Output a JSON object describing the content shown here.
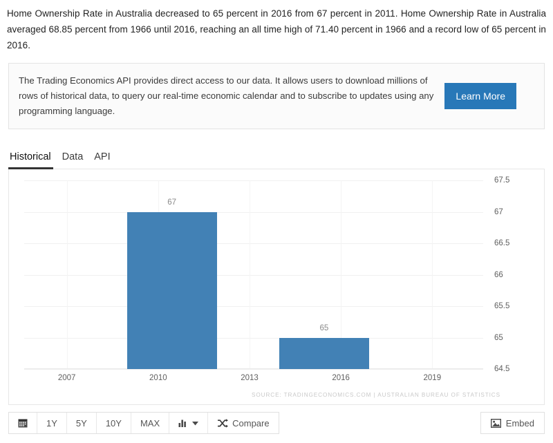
{
  "intro": {
    "paragraph": "Home Ownership Rate in Australia decreased to 65 percent in 2016 from 67 percent in 2011. Home Ownership Rate in Australia averaged 68.85 percent from 1966 until 2016, reaching an all time high of 71.40 percent in 1966 and a record low of 65 percent in 2016."
  },
  "api_promo": {
    "text": "The Trading Economics API provides direct access to our data. It allows users to download millions of rows of historical data, to query our real-time economic calendar and to subscribe to updates using any programming language.",
    "button_label": "Learn More",
    "button_color": "#2878b8"
  },
  "tabs": [
    {
      "label": "Historical",
      "active": true
    },
    {
      "label": "Data",
      "active": false
    },
    {
      "label": "API",
      "active": false
    }
  ],
  "chart_data": {
    "type": "bar",
    "title": "",
    "xlabel": "",
    "ylabel": "",
    "grid": true,
    "legend": false,
    "bar_color": "#4281b5",
    "categories": [
      "2011",
      "2016"
    ],
    "values": [
      67,
      65
    ],
    "data_labels": [
      "67",
      "65"
    ],
    "ylim": [
      64.5,
      67.5
    ],
    "yticks": [
      67.5,
      67,
      66.5,
      66,
      65.5,
      65,
      64.5
    ],
    "ytick_labels": [
      "67.5",
      "67",
      "66.5",
      "66",
      "65.5",
      "65",
      "64.5"
    ],
    "xticks": [
      2007,
      2010,
      2013,
      2016,
      2019
    ],
    "xtick_labels": [
      "2007",
      "2010",
      "2013",
      "2016",
      "2019"
    ],
    "xlim": [
      2005.6,
      2020.4
    ]
  },
  "chart_footer": {
    "source": "SOURCE: TRADINGECONOMICS.COM  |  AUSTRALIAN BUREAU OF STATISTICS"
  },
  "toolbar": {
    "calendar_icon": "calendar-icon",
    "ranges": [
      "1Y",
      "5Y",
      "10Y",
      "MAX"
    ],
    "chart_type_icon": "bar-chart-icon",
    "chart_type_caret": "chevron-down-icon",
    "compare_icon": "shuffle-icon",
    "compare_label": "Compare",
    "embed_icon": "image-icon",
    "embed_label": "Embed"
  }
}
